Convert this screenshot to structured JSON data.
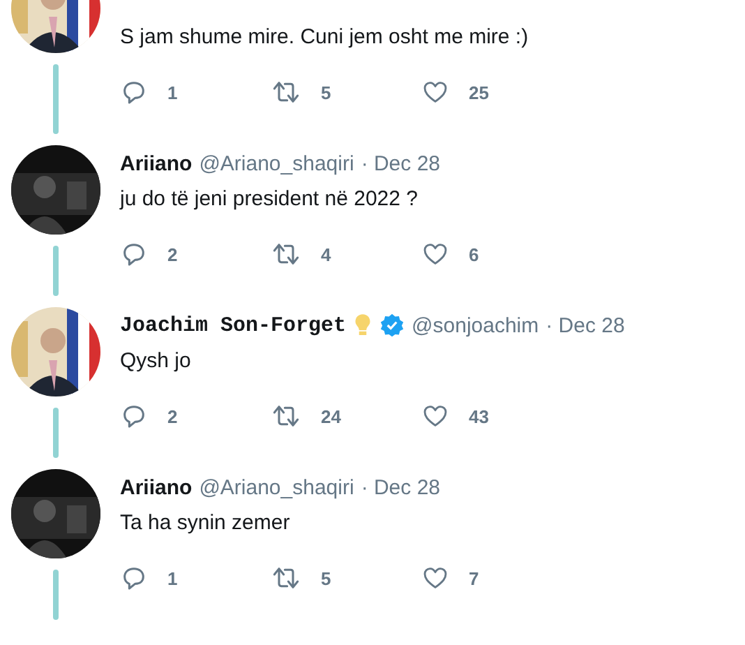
{
  "tweets": [
    {
      "text": "S jam shume mire. Cuni jem osht me mire :)",
      "actions": {
        "replies": "1",
        "retweets": "5",
        "likes": "25"
      }
    },
    {
      "name": "Ariiano",
      "mono_name": false,
      "bulb": false,
      "verified": false,
      "handle": "@Ariano_shaqiri",
      "date": "· Dec 28",
      "text": "ju do të jeni president në 2022 ?",
      "actions": {
        "replies": "2",
        "retweets": "4",
        "likes": "6"
      }
    },
    {
      "name": "Joachim Son-Forget",
      "mono_name": true,
      "bulb": true,
      "verified": true,
      "handle": "@sonjoachim",
      "date": "· Dec 28",
      "text": "Qysh jo",
      "actions": {
        "replies": "2",
        "retweets": "24",
        "likes": "43"
      }
    },
    {
      "name": "Ariiano",
      "mono_name": false,
      "bulb": false,
      "verified": false,
      "handle": "@Ariano_shaqiri",
      "date": "· Dec 28",
      "text": "Ta ha synin zemer",
      "actions": {
        "replies": "1",
        "retweets": "5",
        "likes": "7"
      }
    }
  ]
}
